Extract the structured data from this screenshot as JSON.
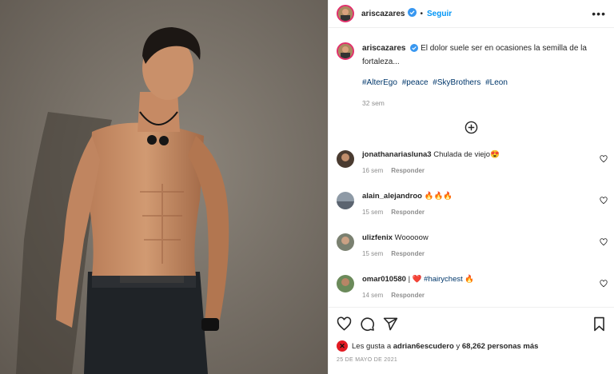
{
  "header": {
    "username": "ariscazares",
    "separator": "•",
    "follow_label": "Seguir",
    "more_label": "•••"
  },
  "caption": {
    "username": "ariscazares",
    "text": "El dolor suele ser en ocasiones la semilla de la fortaleza...",
    "hashtags": [
      "#AlterEgo",
      "#peace",
      "#SkyBrothers",
      "#Leon"
    ],
    "time": "32 sem"
  },
  "comments": [
    {
      "user": "jonathanariasluna3",
      "text": "Chulada de viejo",
      "emoji": "😍",
      "time": "16 sem",
      "reply": "Responder"
    },
    {
      "user": "alain_alejandroo",
      "text": "",
      "emoji": "🔥🔥🔥",
      "time": "15 sem",
      "reply": "Responder"
    },
    {
      "user": "ulizfenix",
      "text": "Wooooow",
      "emoji": "",
      "time": "15 sem",
      "reply": "Responder"
    },
    {
      "user": "omar010580",
      "text": "|",
      "emoji": "❤️",
      "hashtag": "#hairychest",
      "emoji2": "🔥",
      "time": "14 sem",
      "reply": "Responder"
    }
  ],
  "likes": {
    "prefix": "Les gusta a",
    "user": "adrian6escudero",
    "conj": "y",
    "count": "68,262 personas más"
  },
  "date": "25 DE MAYO DE 2021",
  "colors": {
    "link_blue": "#0095f6",
    "hashtag_blue": "#00376b",
    "muted": "#8e8e8e",
    "story_ring": "#e1306c"
  },
  "icons": [
    "verified-badge-icon",
    "more-options-icon",
    "add-comment-icon",
    "heart-icon",
    "comment-icon",
    "share-icon",
    "bookmark-icon"
  ]
}
